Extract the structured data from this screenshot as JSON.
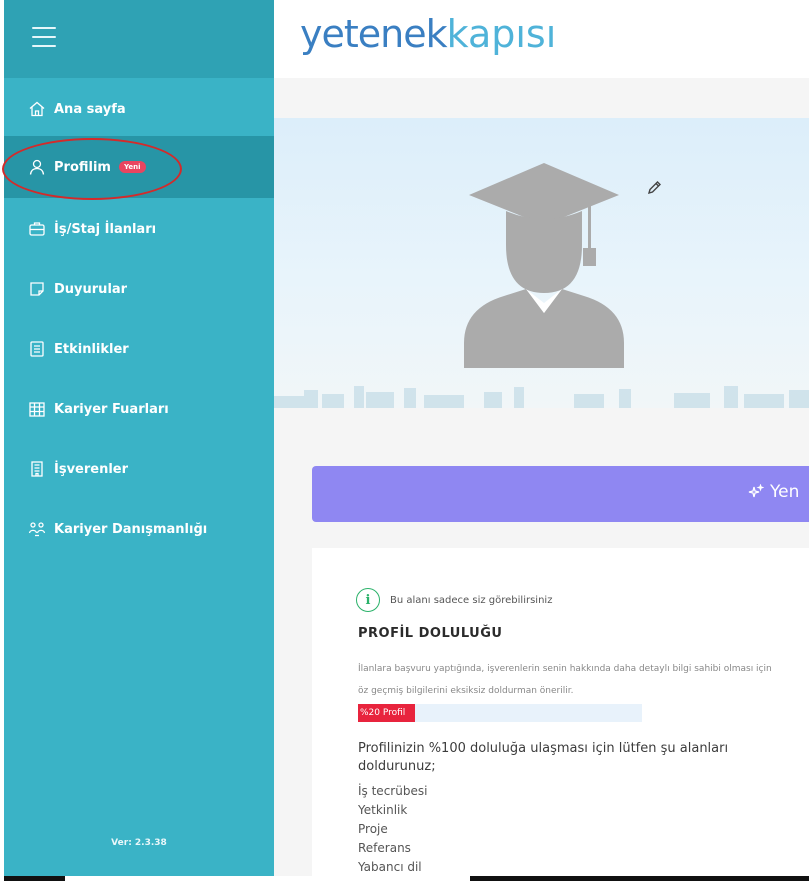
{
  "sidebar": {
    "menu_icon": "hamburger-icon",
    "items": [
      {
        "label": "Ana sayfa",
        "icon": "home-icon",
        "active": false
      },
      {
        "label": "Profilim",
        "icon": "user-icon",
        "active": true,
        "badge": "Yeni"
      },
      {
        "label": "İş/Staj İlanları",
        "icon": "briefcase-icon",
        "active": false
      },
      {
        "label": "Duyurular",
        "icon": "note-icon",
        "active": false
      },
      {
        "label": "Etkinlikler",
        "icon": "list-icon",
        "active": false
      },
      {
        "label": "Kariyer Fuarları",
        "icon": "grid-icon",
        "active": false
      },
      {
        "label": "İşverenler",
        "icon": "building-icon",
        "active": false
      },
      {
        "label": "Kariyer Danışmanlığı",
        "icon": "people-icon",
        "active": false
      }
    ],
    "version": "Ver: 2.3.38"
  },
  "header": {
    "logo_part1": "yetenek",
    "logo_part2": "kapısı"
  },
  "banner": {
    "label": "Yen"
  },
  "profile_card": {
    "visibility_note": "Bu alanı sadece siz görebilirsiniz",
    "title": "PROFİL DOLULUĞU",
    "description": "İlanlara başvuru yaptığında, işverenlerin senin hakkında daha detaylı bilgi sahibi olması için öz geçmiş bilgilerini eksiksiz doldurman önerilir.",
    "progress_label": "%20 Profil",
    "progress_fraction": 0.2,
    "instruction": "Profilinizin %100 doluluğa ulaşması için lütfen şu alanları doldurunuz;",
    "missing_fields": [
      "İş tecrübesi",
      "Yetkinlik",
      "Proje",
      "Referans",
      "Yabancı dil"
    ]
  },
  "colors": {
    "sidebar": "#3ab3c6",
    "sidebar_active": "#2795a6",
    "banner": "#8f87f2",
    "progress": "#e8243d",
    "badge": "#e94560"
  }
}
